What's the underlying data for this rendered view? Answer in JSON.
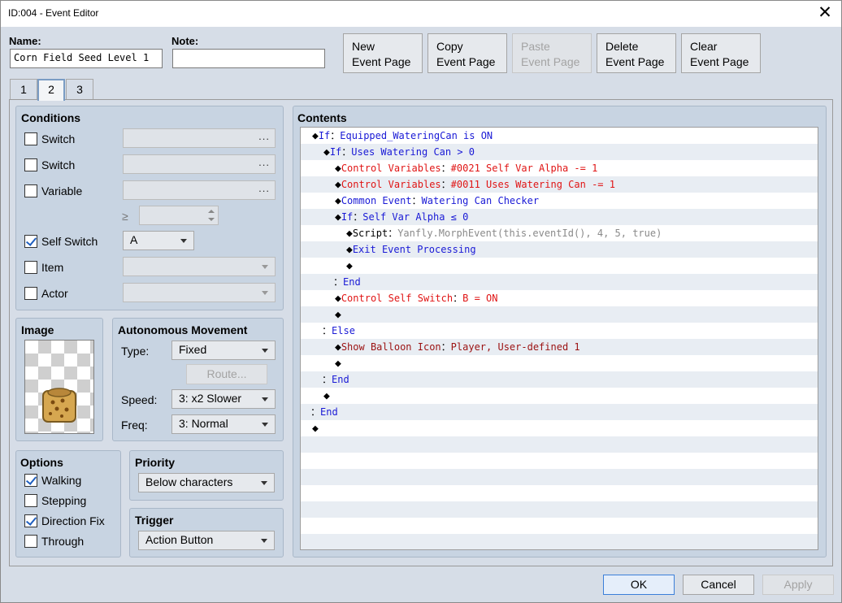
{
  "window": {
    "title": "ID:004 - Event Editor",
    "close_glyph": "✕"
  },
  "name_field": {
    "label": "Name:",
    "value": "Corn Field Seed Level 1"
  },
  "note_field": {
    "label": "Note:",
    "value": ""
  },
  "page_buttons": [
    {
      "line1": "New",
      "line2": "Event Page",
      "enabled": true
    },
    {
      "line1": "Copy",
      "line2": "Event Page",
      "enabled": true
    },
    {
      "line1": "Paste",
      "line2": "Event Page",
      "enabled": false
    },
    {
      "line1": "Delete",
      "line2": "Event Page",
      "enabled": true
    },
    {
      "line1": "Clear",
      "line2": "Event Page",
      "enabled": true
    }
  ],
  "tabs": [
    {
      "label": "1",
      "active": false
    },
    {
      "label": "2",
      "active": true
    },
    {
      "label": "3",
      "active": false
    }
  ],
  "conditions": {
    "title": "Conditions",
    "switch1": {
      "label": "Switch",
      "checked": false,
      "value": "",
      "button": "..."
    },
    "switch2": {
      "label": "Switch",
      "checked": false,
      "value": "",
      "button": "..."
    },
    "variable": {
      "label": "Variable",
      "checked": false,
      "value": "",
      "button": "...",
      "op": "≥",
      "amount": ""
    },
    "self_switch": {
      "label": "Self Switch",
      "checked": true,
      "value": "A"
    },
    "item": {
      "label": "Item",
      "checked": false,
      "value": ""
    },
    "actor": {
      "label": "Actor",
      "checked": false,
      "value": ""
    }
  },
  "image": {
    "title": "Image",
    "sprite": "corn-seed-sack"
  },
  "autonomous_movement": {
    "title": "Autonomous Movement",
    "type_label": "Type:",
    "type_value": "Fixed",
    "route_button": "Route...",
    "speed_label": "Speed:",
    "speed_value": "3: x2 Slower",
    "freq_label": "Freq:",
    "freq_value": "3: Normal"
  },
  "options": {
    "title": "Options",
    "walking": {
      "label": "Walking",
      "checked": true
    },
    "stepping": {
      "label": "Stepping",
      "checked": false
    },
    "direction_fix": {
      "label": "Direction Fix",
      "checked": true
    },
    "through": {
      "label": "Through",
      "checked": false
    }
  },
  "priority": {
    "title": "Priority",
    "value": "Below characters"
  },
  "trigger": {
    "title": "Trigger",
    "value": "Action Button"
  },
  "contents": {
    "title": "Contents",
    "rows": [
      {
        "indent": 0,
        "diamond": true,
        "parts": [
          {
            "t": "If",
            "c": "blue"
          },
          {
            "t": "：",
            "c": "black"
          },
          {
            "t": "Equipped_WateringCan is ON",
            "c": "blue"
          }
        ]
      },
      {
        "indent": 1,
        "diamond": true,
        "parts": [
          {
            "t": "If",
            "c": "blue"
          },
          {
            "t": "：",
            "c": "black"
          },
          {
            "t": "Uses Watering Can > 0",
            "c": "blue"
          }
        ]
      },
      {
        "indent": 2,
        "diamond": true,
        "parts": [
          {
            "t": "Control Variables",
            "c": "red"
          },
          {
            "t": "：",
            "c": "black"
          },
          {
            "t": "#0021 Self Var Alpha -= 1",
            "c": "red"
          }
        ]
      },
      {
        "indent": 2,
        "diamond": true,
        "parts": [
          {
            "t": "Control Variables",
            "c": "red"
          },
          {
            "t": "：",
            "c": "black"
          },
          {
            "t": "#0011 Uses Watering Can -= 1",
            "c": "red"
          }
        ]
      },
      {
        "indent": 2,
        "diamond": true,
        "parts": [
          {
            "t": "Common Event",
            "c": "blue"
          },
          {
            "t": "：",
            "c": "black"
          },
          {
            "t": "Watering Can Checker",
            "c": "blue"
          }
        ]
      },
      {
        "indent": 2,
        "diamond": true,
        "parts": [
          {
            "t": "If",
            "c": "blue"
          },
          {
            "t": "：",
            "c": "black"
          },
          {
            "t": "Self Var Alpha ≤ 0",
            "c": "blue"
          }
        ]
      },
      {
        "indent": 3,
        "diamond": true,
        "parts": [
          {
            "t": "Script",
            "c": "black"
          },
          {
            "t": "：",
            "c": "black"
          },
          {
            "t": "Yanfly.MorphEvent(this.eventId(), 4, 5, true)",
            "c": "gray"
          }
        ]
      },
      {
        "indent": 3,
        "diamond": true,
        "parts": [
          {
            "t": "Exit Event Processing",
            "c": "blue"
          }
        ]
      },
      {
        "indent": 3,
        "diamond": true,
        "parts": []
      },
      {
        "indent": 2,
        "diamond": false,
        "parts": [
          {
            "t": "：",
            "c": "black"
          },
          {
            "t": "End",
            "c": "blue"
          }
        ]
      },
      {
        "indent": 2,
        "diamond": true,
        "parts": [
          {
            "t": "Control Self Switch",
            "c": "red"
          },
          {
            "t": "：",
            "c": "black"
          },
          {
            "t": "B = ON",
            "c": "red"
          }
        ]
      },
      {
        "indent": 2,
        "diamond": true,
        "parts": []
      },
      {
        "indent": 1,
        "diamond": false,
        "parts": [
          {
            "t": "：",
            "c": "black"
          },
          {
            "t": "Else",
            "c": "blue"
          }
        ]
      },
      {
        "indent": 2,
        "diamond": true,
        "parts": [
          {
            "t": "Show Balloon Icon",
            "c": "darkred"
          },
          {
            "t": "：",
            "c": "black"
          },
          {
            "t": "Player, User-defined 1",
            "c": "darkred"
          }
        ]
      },
      {
        "indent": 2,
        "diamond": true,
        "parts": []
      },
      {
        "indent": 1,
        "diamond": false,
        "parts": [
          {
            "t": "：",
            "c": "black"
          },
          {
            "t": "End",
            "c": "blue"
          }
        ]
      },
      {
        "indent": 1,
        "diamond": true,
        "parts": []
      },
      {
        "indent": 0,
        "diamond": false,
        "parts": [
          {
            "t": "：",
            "c": "black"
          },
          {
            "t": "End",
            "c": "blue"
          }
        ]
      },
      {
        "indent": 0,
        "diamond": true,
        "parts": []
      }
    ]
  },
  "footer": {
    "ok": "OK",
    "cancel": "Cancel",
    "apply": "Apply"
  },
  "colors": {
    "blue": "#1a1ad6",
    "red": "#e01515",
    "darkred": "#9b1111",
    "gray": "#8a8a8a",
    "accent": "#3b7fd9"
  }
}
